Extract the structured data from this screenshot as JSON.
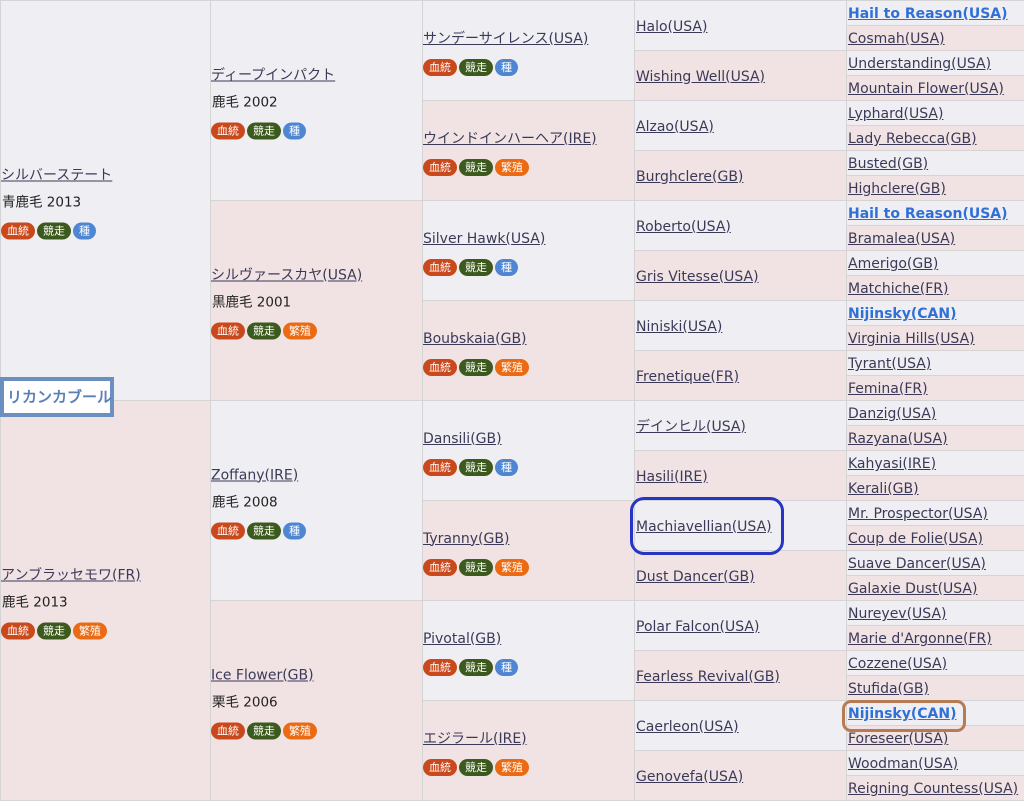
{
  "self_name": "リカンカブール",
  "badge_labels": {
    "ketto": "血統",
    "kyoso": "競走",
    "shu": "種",
    "hanshoku": "繁殖"
  },
  "gen1": [
    {
      "name": "シルバーステート",
      "meta": "青鹿毛 2013",
      "badges": [
        "ketto",
        "kyoso",
        "shu"
      ]
    },
    {
      "name": "アンブラッセモワ(FR)",
      "meta": "鹿毛 2013",
      "badges": [
        "ketto",
        "kyoso",
        "hanshoku"
      ]
    }
  ],
  "gen2": [
    {
      "name": "ディープインパクト",
      "meta": "鹿毛 2002",
      "badges": [
        "ketto",
        "kyoso",
        "shu"
      ]
    },
    {
      "name": "シルヴァースカヤ(USA)",
      "meta": "黒鹿毛 2001",
      "badges": [
        "ketto",
        "kyoso",
        "hanshoku"
      ]
    },
    {
      "name": "Zoffany(IRE)",
      "meta": "鹿毛 2008",
      "badges": [
        "ketto",
        "kyoso",
        "shu"
      ]
    },
    {
      "name": "Ice Flower(GB)",
      "meta": "栗毛 2006",
      "badges": [
        "ketto",
        "kyoso",
        "hanshoku"
      ]
    }
  ],
  "gen3": [
    {
      "name": "サンデーサイレンス(USA)",
      "badges": [
        "ketto",
        "kyoso",
        "shu"
      ]
    },
    {
      "name": "ウインドインハーヘア(IRE)",
      "badges": [
        "ketto",
        "kyoso",
        "hanshoku"
      ]
    },
    {
      "name": "Silver Hawk(USA)",
      "badges": [
        "ketto",
        "kyoso",
        "shu"
      ]
    },
    {
      "name": "Boubskaia(GB)",
      "badges": [
        "ketto",
        "kyoso",
        "hanshoku"
      ]
    },
    {
      "name": "Dansili(GB)",
      "badges": [
        "ketto",
        "kyoso",
        "shu"
      ]
    },
    {
      "name": "Tyranny(GB)",
      "badges": [
        "ketto",
        "kyoso",
        "hanshoku"
      ]
    },
    {
      "name": "Pivotal(GB)",
      "badges": [
        "ketto",
        "kyoso",
        "shu"
      ]
    },
    {
      "name": "エジラール(IRE)",
      "badges": [
        "ketto",
        "kyoso",
        "hanshoku"
      ]
    }
  ],
  "gen4": [
    {
      "name": "Halo(USA)"
    },
    {
      "name": "Wishing Well(USA)"
    },
    {
      "name": "Alzao(USA)"
    },
    {
      "name": "Burghclere(GB)"
    },
    {
      "name": "Roberto(USA)"
    },
    {
      "name": "Gris Vitesse(USA)"
    },
    {
      "name": "Niniski(USA)"
    },
    {
      "name": "Frenetique(FR)"
    },
    {
      "name": "デインヒル(USA)"
    },
    {
      "name": "Hasili(IRE)"
    },
    {
      "name": "Machiavellian(USA)"
    },
    {
      "name": "Dust Dancer(GB)"
    },
    {
      "name": "Polar Falcon(USA)"
    },
    {
      "name": "Fearless Revival(GB)"
    },
    {
      "name": "Caerleon(USA)"
    },
    {
      "name": "Genovefa(USA)"
    }
  ],
  "gen5": [
    {
      "name": "Hail to Reason(USA)",
      "strong": true
    },
    {
      "name": "Cosmah(USA)"
    },
    {
      "name": "Understanding(USA)"
    },
    {
      "name": "Mountain Flower(USA)"
    },
    {
      "name": "Lyphard(USA)"
    },
    {
      "name": "Lady Rebecca(GB)"
    },
    {
      "name": "Busted(GB)"
    },
    {
      "name": "Highclere(GB)"
    },
    {
      "name": "Hail to Reason(USA)",
      "strong": true
    },
    {
      "name": "Bramalea(USA)"
    },
    {
      "name": "Amerigo(GB)"
    },
    {
      "name": "Matchiche(FR)"
    },
    {
      "name": "Nijinsky(CAN)",
      "strong": true
    },
    {
      "name": "Virginia Hills(USA)"
    },
    {
      "name": "Tyrant(USA)"
    },
    {
      "name": "Femina(FR)"
    },
    {
      "name": "Danzig(USA)"
    },
    {
      "name": "Razyana(USA)"
    },
    {
      "name": "Kahyasi(IRE)"
    },
    {
      "name": "Kerali(GB)"
    },
    {
      "name": "Mr. Prospector(USA)"
    },
    {
      "name": "Coup de Folie(USA)"
    },
    {
      "name": "Suave Dancer(USA)"
    },
    {
      "name": "Galaxie Dust(USA)"
    },
    {
      "name": "Nureyev(USA)"
    },
    {
      "name": "Marie d'Argonne(FR)"
    },
    {
      "name": "Cozzene(USA)"
    },
    {
      "name": "Stufida(GB)"
    },
    {
      "name": "Nijinsky(CAN)",
      "strong": true
    },
    {
      "name": "Foreseer(USA)"
    },
    {
      "name": "Woodman(USA)"
    },
    {
      "name": "Reigning Countess(USA)"
    }
  ]
}
